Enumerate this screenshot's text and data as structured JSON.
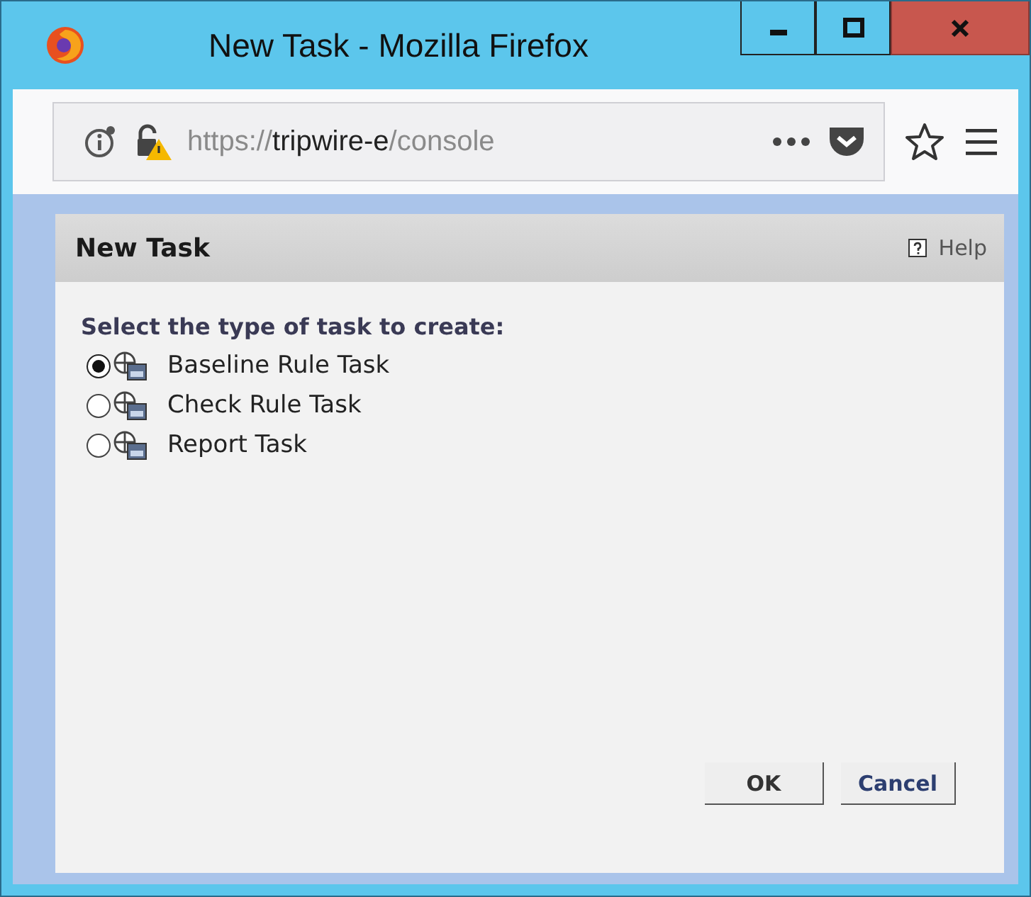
{
  "window": {
    "title": "New Task - Mozilla Firefox"
  },
  "address_bar": {
    "url_scheme": "https://",
    "url_host": "tripwire-e",
    "url_path": "/console"
  },
  "dialog": {
    "title": "New Task",
    "help": "Help",
    "prompt": "Select the type of task to create:",
    "options": [
      {
        "label": "Baseline Rule Task",
        "selected": true
      },
      {
        "label": "Check Rule Task",
        "selected": false
      },
      {
        "label": "Report Task",
        "selected": false
      }
    ],
    "buttons": [
      {
        "label": "OK",
        "kind": "ok"
      },
      {
        "label": "Cancel",
        "kind": "cancel"
      }
    ]
  }
}
